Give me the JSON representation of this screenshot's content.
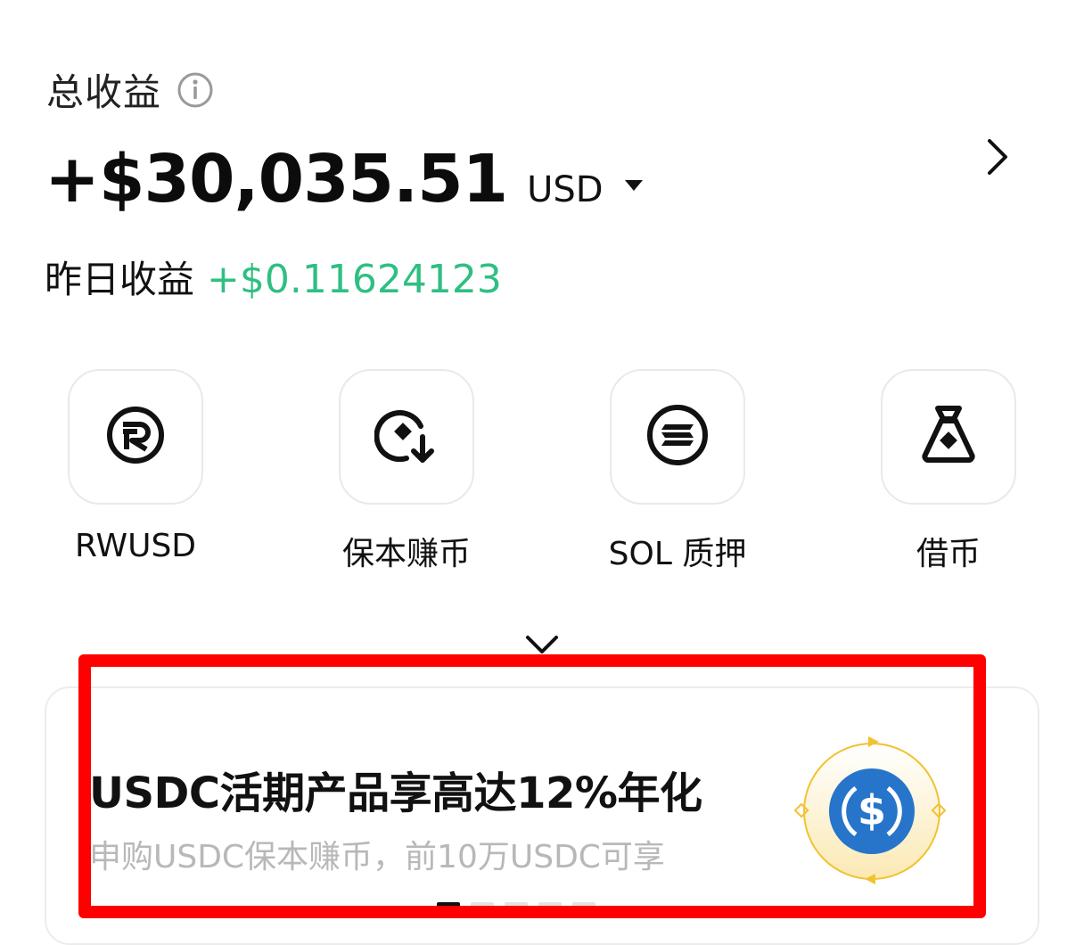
{
  "summary": {
    "total_label": "总收益",
    "total_value": "+$30,035.51",
    "currency": "USD",
    "yesterday_label": "昨日收益",
    "yesterday_value": "+$0.11624123"
  },
  "actions": [
    {
      "label": "RWUSD",
      "icon": "rwusd-icon"
    },
    {
      "label": "保本赚币",
      "icon": "earn-icon"
    },
    {
      "label": "SOL 质押",
      "icon": "sol-icon"
    },
    {
      "label": "借币",
      "icon": "loan-bag-icon"
    }
  ],
  "banner": {
    "title": "USDC活期产品享高达12%年化",
    "subtitle": "申购USDC保本赚币，前10万USDC可享",
    "coin_icon": "usdc-icon",
    "pages": 5,
    "active_page": 1
  },
  "colors": {
    "positive": "#2fbf82",
    "highlight": "#ff0000",
    "usdc_blue": "#2775ca",
    "gold": "#f2c230"
  }
}
